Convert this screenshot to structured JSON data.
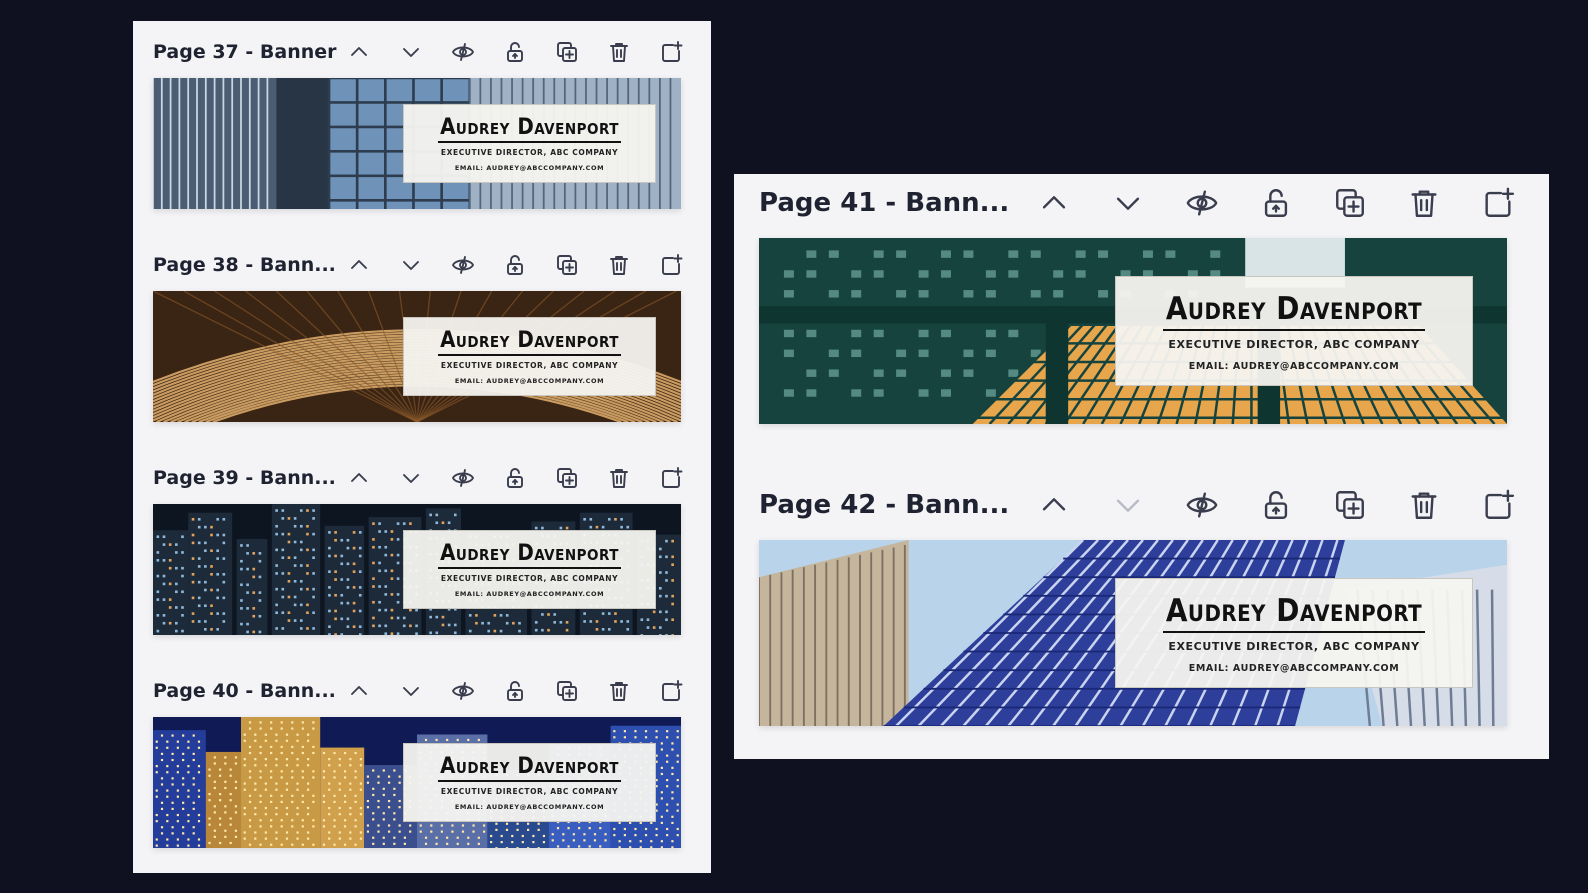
{
  "colors": {
    "background": "#0f1020",
    "panel": "#f4f4f7",
    "icon": "#3a3d4d",
    "icon_disabled": "#b9bcc7"
  },
  "banner_card": {
    "name": "Audrey Davenport",
    "role": "Executive Director, ABC Company",
    "email": "Email: audrey@abccompany.com"
  },
  "tool_icons": [
    "chevron-up-icon",
    "chevron-down-icon",
    "hide-eye-icon",
    "lock-icon",
    "duplicate-icon",
    "trash-icon",
    "add-page-icon"
  ],
  "pages": [
    {
      "title": "Page 37 - Banner",
      "theme": "glass-tower",
      "down_enabled": true
    },
    {
      "title": "Page 38 - Bann...",
      "theme": "wooden-roof",
      "down_enabled": true
    },
    {
      "title": "Page 39 - Bann...",
      "theme": "night-city",
      "down_enabled": true
    },
    {
      "title": "Page 40 - Bann...",
      "theme": "marina-night",
      "down_enabled": true
    },
    {
      "title": "Page 41 - Bann...",
      "theme": "green-steel",
      "down_enabled": true
    },
    {
      "title": "Page 42 - Bann...",
      "theme": "blue-skyscraper",
      "down_enabled": false
    }
  ]
}
